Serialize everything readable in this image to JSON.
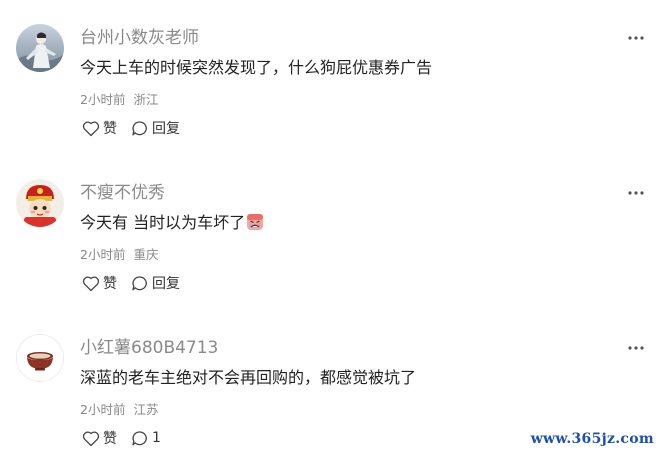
{
  "comments": [
    {
      "username": "台州小数灰老师",
      "content": "今天上车的时候突然发现了，什么狗屁优惠券广告",
      "time": "2小时前",
      "location": "浙江",
      "like_label": "赞",
      "reply_label": "回复",
      "avatar_icon": "figure-avatar-icon"
    },
    {
      "username": "不瘦不优秀",
      "content": "今天有 当时以为车坏了",
      "emoji": "crying-face-emoji",
      "time": "2小时前",
      "location": "重庆",
      "like_label": "赞",
      "reply_label": "回复",
      "avatar_icon": "cartoon-character-avatar-icon"
    },
    {
      "username": "小红薯680B4713",
      "content": "深蓝的老车主绝对不会再回购的，都感觉被坑了",
      "time": "2小时前",
      "location": "江苏",
      "like_label": "赞",
      "reply_label": "1",
      "avatar_icon": "bowl-avatar-icon"
    }
  ],
  "watermark": "www.365jz.com"
}
